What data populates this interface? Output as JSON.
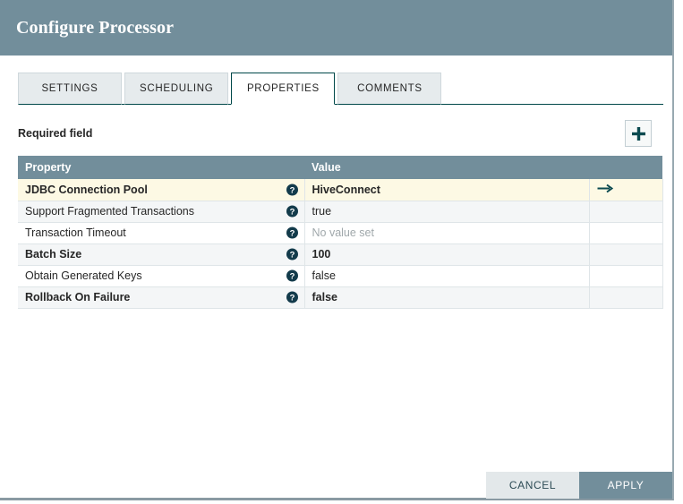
{
  "dialog": {
    "title": "Configure Processor"
  },
  "tabs": [
    {
      "label": "SETTINGS",
      "active": false
    },
    {
      "label": "SCHEDULING",
      "active": false
    },
    {
      "label": "PROPERTIES",
      "active": true
    },
    {
      "label": "COMMENTS",
      "active": false
    }
  ],
  "toolbar": {
    "required_field_label": "Required field",
    "add_icon": "plus-icon"
  },
  "table": {
    "columns": [
      "Property",
      "Value",
      ""
    ],
    "rows": [
      {
        "property": "JDBC Connection Pool",
        "value": "HiveConnect",
        "required": true,
        "unset": false,
        "selected": true,
        "action_icon": "go-to-arrow-icon",
        "help_icon": "help-icon"
      },
      {
        "property": "Support Fragmented Transactions",
        "value": "true",
        "required": false,
        "unset": false,
        "selected": false,
        "action_icon": "",
        "help_icon": "help-icon"
      },
      {
        "property": "Transaction Timeout",
        "value": "No value set",
        "required": false,
        "unset": true,
        "selected": false,
        "action_icon": "",
        "help_icon": "help-icon"
      },
      {
        "property": "Batch Size",
        "value": "100",
        "required": true,
        "unset": false,
        "selected": false,
        "action_icon": "",
        "help_icon": "help-icon"
      },
      {
        "property": "Obtain Generated Keys",
        "value": "false",
        "required": false,
        "unset": false,
        "selected": false,
        "action_icon": "",
        "help_icon": "help-icon"
      },
      {
        "property": "Rollback On Failure",
        "value": "false",
        "required": true,
        "unset": false,
        "selected": false,
        "action_icon": "",
        "help_icon": "help-icon"
      }
    ]
  },
  "footer": {
    "cancel_label": "CANCEL",
    "apply_label": "APPLY"
  },
  "colors": {
    "header_bg": "#728e9b",
    "accent_teal": "#004849",
    "selected_row": "#fdf9e4",
    "stripe_row": "#f4f6f7",
    "help_icon": "#133b4b",
    "apply_bg": "#728e9b",
    "cancel_bg": "#e3e8ea"
  }
}
